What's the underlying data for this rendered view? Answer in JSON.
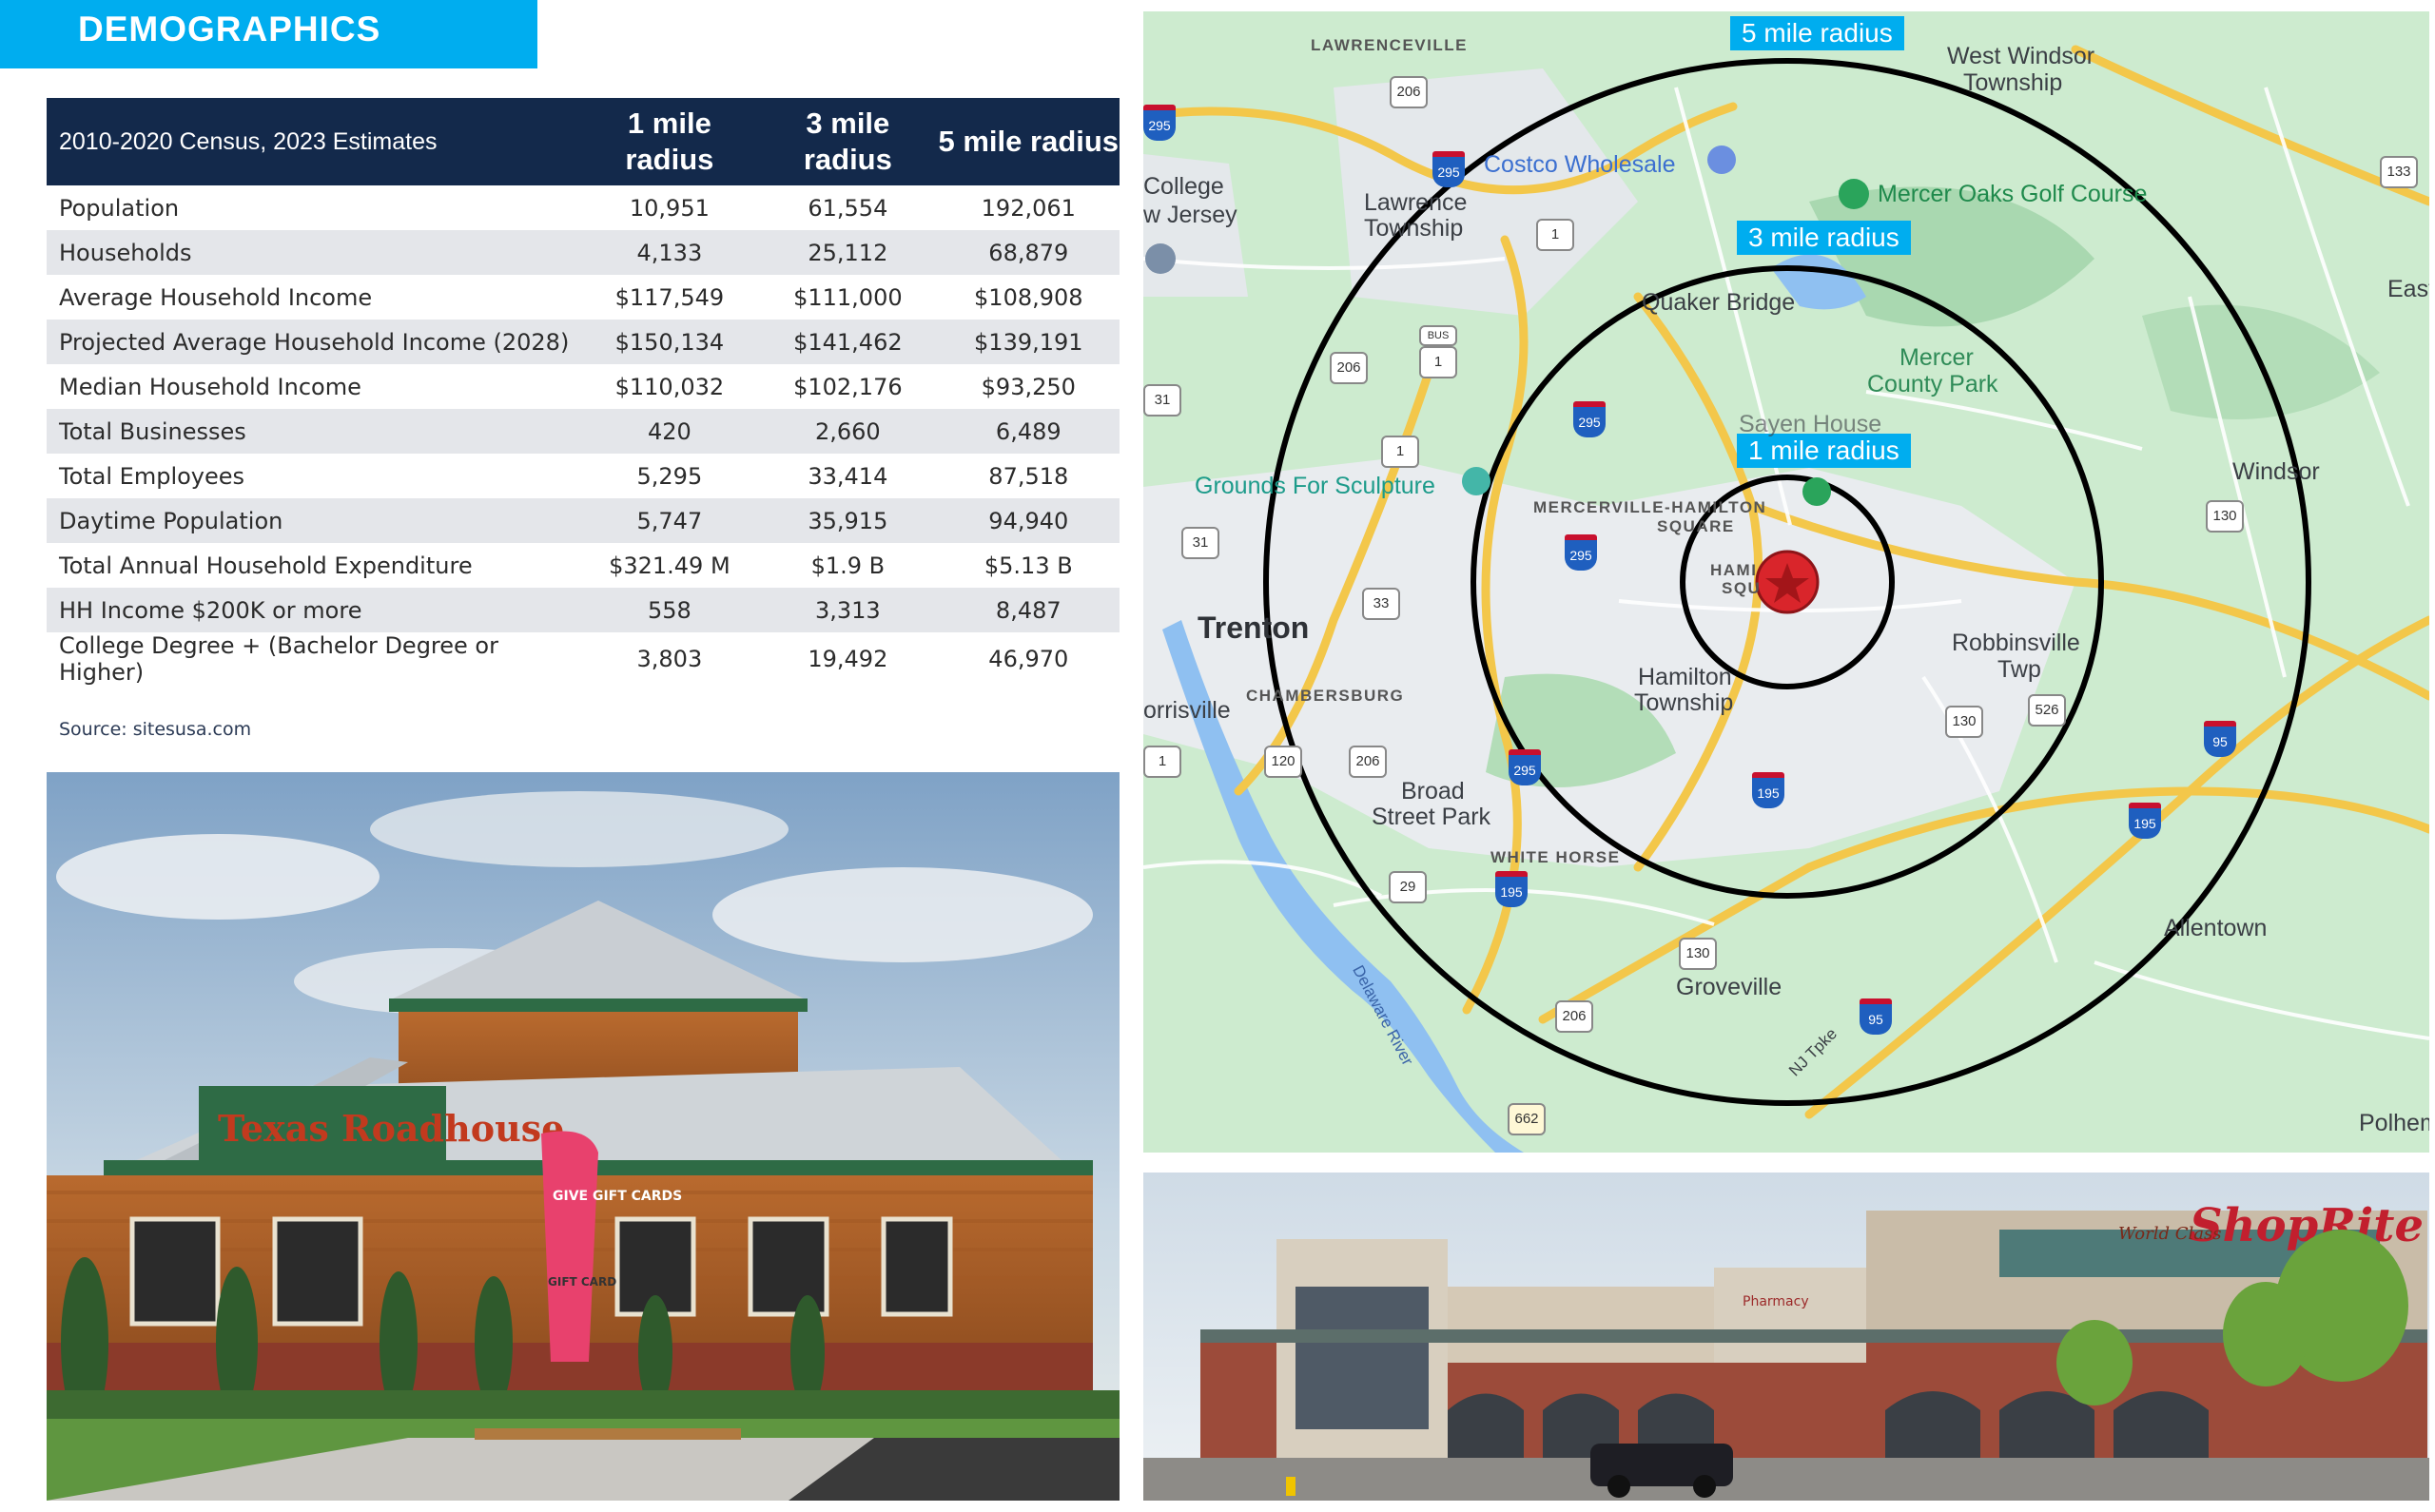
{
  "banner": {
    "title": "DEMOGRAPHICS"
  },
  "table": {
    "header": [
      "2010-2020 Census, 2023 Estimates",
      "1 mile radius",
      "3 mile radius",
      "5 mile radius"
    ],
    "rows": [
      [
        "Population",
        "10,951",
        "61,554",
        "192,061"
      ],
      [
        "Households",
        "4,133",
        "25,112",
        "68,879"
      ],
      [
        "Average Household Income",
        "$117,549",
        "$111,000",
        "$108,908"
      ],
      [
        "Projected Average Household Income (2028)",
        "$150,134",
        "$141,462",
        "$139,191"
      ],
      [
        "Median Household Income",
        "$110,032",
        "$102,176",
        "$93,250"
      ],
      [
        "Total Businesses",
        "420",
        "2,660",
        "6,489"
      ],
      [
        "Total Employees",
        "5,295",
        "33,414",
        "87,518"
      ],
      [
        "Daytime Population",
        "5,747",
        "35,915",
        "94,940"
      ],
      [
        "Total Annual Household Expenditure",
        "$321.49 M",
        "$1.9 B",
        "$5.13 B"
      ],
      [
        "HH Income $200K or more",
        "558",
        "3,313",
        "8,487"
      ],
      [
        "College Degree + (Bachelor Degree or Higher)",
        "3,803",
        "19,492",
        "46,970"
      ]
    ],
    "source": "Source: sitesusa.com"
  },
  "map": {
    "radius_tags": {
      "five": "5 mile radius",
      "three": "3 mile radius",
      "one": "1 mile radius"
    },
    "places": {
      "lawrenceville": "LAWRENCEVILLE",
      "west_windsor": "West Windsor",
      "west_windsor_2": "Township",
      "costco": "Costco Wholesale",
      "college": "College",
      "college_2": "w Jersey",
      "lawrence": "Lawrence",
      "lawrence_2": "Township",
      "mercer_oaks": "Mercer Oaks Golf Course",
      "east": "East",
      "quaker": "Quaker Bridge",
      "mercer_park": "Mercer",
      "mercer_park_2": "County Park",
      "sayen": "Sayen House",
      "grounds": "Grounds For Sculpture",
      "windsor": "Windsor",
      "mercerville": "MERCERVILLE-HAMILTON",
      "mercerville_2": "SQUARE",
      "hami": "HAMI",
      "squ": "SQU",
      "trenton": "Trenton",
      "robbinsville": "Robbinsville",
      "robbinsville_2": "Twp",
      "chambersburg": "CHAMBERSBURG",
      "hamilton": "Hamilton",
      "hamilton_2": "Township",
      "morrisville": "orrisville",
      "broad": "Broad",
      "broad_2": "Street Park",
      "white_horse": "WHITE HORSE",
      "delaware": "Delaware River",
      "groveville": "Groveville",
      "allentown": "Allentown",
      "polhemus": "Polhemu",
      "nj_tpke": "NJ Tpke"
    },
    "shields": {
      "s295a": "295",
      "s206a": "206",
      "s295b": "295",
      "s1a": "1",
      "bus": "BUS",
      "s1bus": "1",
      "s206b": "206",
      "s31a": "31",
      "s295c": "295",
      "s1b": "1",
      "s31b": "31",
      "s295d": "295",
      "s33": "33",
      "s130a": "130",
      "s130b": "130",
      "s526": "526",
      "s95a": "95",
      "s120": "120",
      "s206c": "206",
      "s295e": "295",
      "s195a": "195",
      "s195b": "195",
      "s29": "29",
      "s195c": "195",
      "s130c": "130",
      "s206d": "206",
      "s95b": "95",
      "s662": "662",
      "s133": "133",
      "s1c": "1"
    }
  },
  "photos": {
    "restaurant_sign": "Texas Roadhouse",
    "banner_text": "GIVE GIFT CARDS",
    "sign_text": "GIFT CARD",
    "store_sign": "ShopRite",
    "store_sign_2": "World Class",
    "pharmacy": "Pharmacy"
  }
}
